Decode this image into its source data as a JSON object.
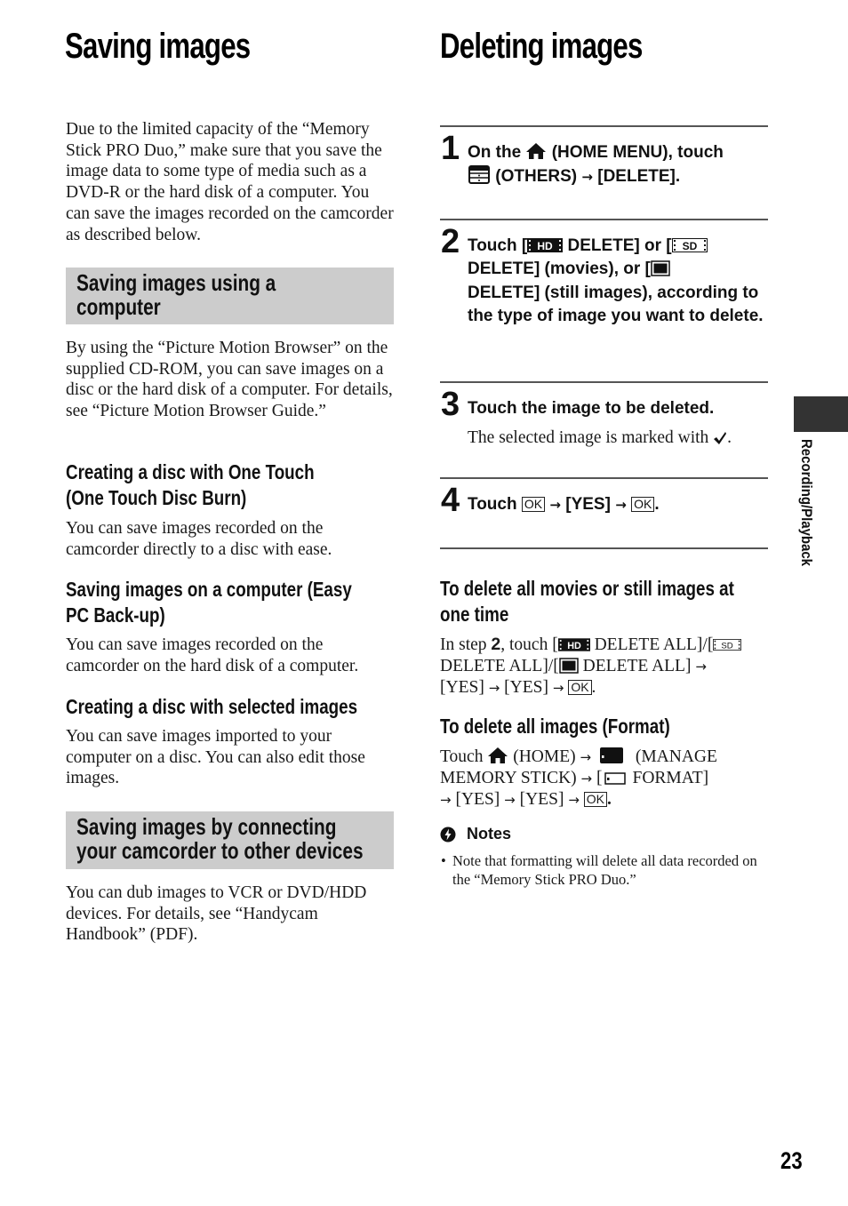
{
  "left": {
    "title": "Saving images",
    "intro": "Due to the limited capacity of the “Memory Stick PRO Duo,” make sure that you save the image data to some type of media such as a DVD-R or the hard disk of a computer. You can save the images recorded on the camcorder as described below.",
    "section1": {
      "heading_line1": "Saving images using a",
      "heading_line2": "computer",
      "body": "By using the “Picture Motion Browser” on the supplied CD-ROM, you can save images on a disc or the hard disk of a computer. For details, see “Picture Motion Browser Guide.”",
      "subsections": [
        {
          "heading_line1": "Creating a disc with One Touch",
          "heading_line2": "(One Touch Disc Burn)",
          "body": "You can save images recorded on the camcorder directly to a disc with ease."
        },
        {
          "heading_line1": "Saving images on a computer (Easy",
          "heading_line2": "PC Back-up)",
          "body": "You can save images recorded on the camcorder on the hard disk of a computer."
        },
        {
          "heading_line1": "Creating a disc with selected images",
          "heading_line2": "",
          "body": "You can save images imported to your computer on a disc. You can also edit those images."
        }
      ]
    },
    "section2": {
      "heading_line1": "Saving images by connecting",
      "heading_line2": "your camcorder to other devices",
      "body": "You can dub images to VCR or DVD/HDD devices. For details, see “Handycam Handbook” (PDF)."
    }
  },
  "right": {
    "title": "Deleting images",
    "steps": [
      {
        "number": "1",
        "parts": [
          "On the",
          "(HOME MENU), touch",
          "(OTHERS)",
          "→",
          "[DELETE]."
        ]
      },
      {
        "number": "2",
        "parts": [
          "Touch [",
          "DELETE] or [",
          "DELETE] (movies), or [",
          "DELETE] (still images), according to the type of image you want to delete."
        ]
      },
      {
        "number": "3",
        "text": "Touch the image to be deleted.",
        "sub": "The selected image is marked with"
      },
      {
        "number": "4",
        "parts": [
          "Touch",
          "→",
          "[YES]",
          "→"
        ]
      }
    ],
    "delete_all": {
      "heading_line1": "To delete all movies or still images at",
      "heading_line2": "one time",
      "parts": [
        "In step",
        "2",
        ", touch [",
        "DELETE ALL]/[",
        "DELETE ALL]/[",
        "DELETE ALL]",
        "[YES]",
        "[YES]"
      ]
    },
    "format": {
      "heading": "To delete all images (Format)",
      "parts": [
        "Touch",
        "(HOME)",
        "(MANAGE MEMORY STICK)",
        "[",
        "FORMAT]",
        "[YES]",
        "[YES]"
      ]
    },
    "notes": {
      "heading": "Notes",
      "items": [
        "Note that formatting will delete all data recorded on the “Memory Stick PRO Duo.”"
      ]
    },
    "ok_label": "OK",
    "arrow": "→",
    "hd_label": "HD",
    "sd_label": "SD"
  },
  "side_tab": {
    "label": "Recording/Playback",
    "color": "#333333"
  },
  "page_number": "23"
}
